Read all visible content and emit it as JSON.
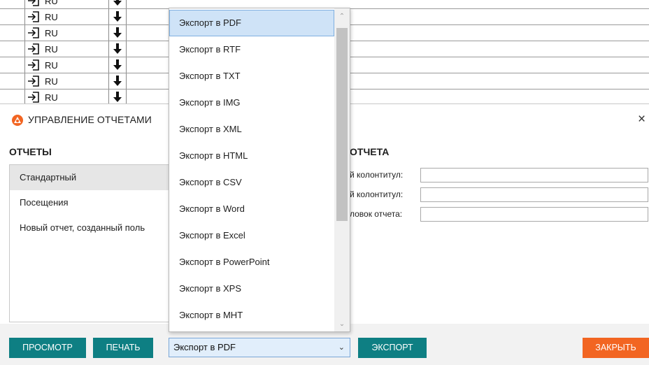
{
  "background_table": {
    "rows": [
      {
        "lang": "RU"
      },
      {
        "lang": "RU"
      },
      {
        "lang": "RU"
      },
      {
        "lang": "RU"
      },
      {
        "lang": "RU"
      },
      {
        "lang": "RU"
      },
      {
        "lang": "RU"
      }
    ]
  },
  "dialog": {
    "title": "УПРАВЛЕНИЕ ОТЧЕТАМИ",
    "close": "×",
    "reports_title": "ОТЧЕТЫ",
    "reports": [
      {
        "label": "Стандартный",
        "selected": true
      },
      {
        "label": "Посещения",
        "selected": false
      },
      {
        "label": "Новый отчет, созданный поль",
        "selected": false
      }
    ],
    "properties_title": "ОТЧЕТА",
    "properties": [
      {
        "label": "й колонтитул:",
        "value": ""
      },
      {
        "label": "й колонтитул:",
        "value": ""
      },
      {
        "label": "ловок отчета:",
        "value": ""
      }
    ]
  },
  "footer": {
    "preview_label": "ПРОСМОТР",
    "print_label": "ПЕЧАТЬ",
    "export_format_selected": "Экспорт в PDF",
    "export_label": "ЭКСПОРТ",
    "close_label": "ЗАКРЫТЬ"
  },
  "dropdown": {
    "options": [
      "Экспорт в PDF",
      "Экспорт в RTF",
      "Экспорт в TXT",
      "Экспорт в IMG",
      "Экспорт в XML",
      "Экспорт в HTML",
      "Экспорт в CSV",
      "Экспорт в Word",
      "Экспорт в Excel",
      "Экспорт в PowerPoint",
      "Экспорт в XPS",
      "Экспорт в MHT"
    ],
    "selected_index": 0
  },
  "colors": {
    "accent_teal": "#0e7f83",
    "accent_orange": "#f26522",
    "selection_blue": "#cfe3f7"
  },
  "icons": {
    "row_left": "sign-in-icon",
    "row_right": "arrow-down-icon",
    "app": "app-logo-icon",
    "chevron": "chevron-down-icon"
  }
}
